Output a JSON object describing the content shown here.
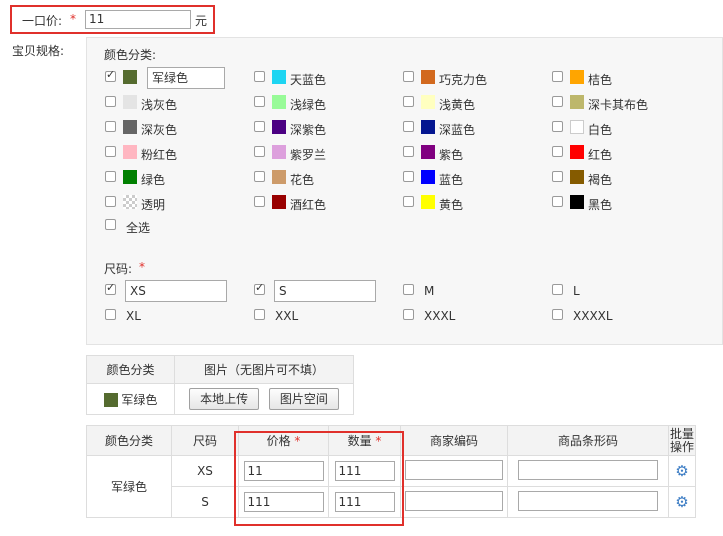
{
  "price": {
    "label": "一口价:",
    "required_mark": "*",
    "value": "11",
    "unit": "元"
  },
  "spec_label": "宝贝规格:",
  "colors": {
    "heading": "颜色分类:",
    "items": [
      {
        "label": "军绿色",
        "color": "#556b2f",
        "checked": true
      },
      {
        "label": "天蓝色",
        "color": "#1ed5f2",
        "checked": false
      },
      {
        "label": "巧克力色",
        "color": "#d2691e",
        "checked": false
      },
      {
        "label": "桔色",
        "color": "#ffa500",
        "checked": false
      },
      {
        "label": "浅灰色",
        "color": "#e4e4e4",
        "checked": false
      },
      {
        "label": "浅绿色",
        "color": "#98fb98",
        "checked": false
      },
      {
        "label": "浅黄色",
        "color": "#ffffc0",
        "checked": false
      },
      {
        "label": "深卡其布色",
        "color": "#bdb76b",
        "checked": false
      },
      {
        "label": "深灰色",
        "color": "#666666",
        "checked": false
      },
      {
        "label": "深紫色",
        "color": "#4b0082",
        "checked": false
      },
      {
        "label": "深蓝色",
        "color": "#041690",
        "checked": false
      },
      {
        "label": "白色",
        "color": "#ffffff",
        "checked": false
      },
      {
        "label": "粉红色",
        "color": "#ffb6c1",
        "checked": false
      },
      {
        "label": "紫罗兰",
        "color": "#dda0dd",
        "checked": false
      },
      {
        "label": "紫色",
        "color": "#800080",
        "checked": false
      },
      {
        "label": "红色",
        "color": "#ff0000",
        "checked": false
      },
      {
        "label": "绿色",
        "color": "#008000",
        "checked": false
      },
      {
        "label": "花色",
        "color": "#cd9b6a",
        "checked": false
      },
      {
        "label": "蓝色",
        "color": "#0000ff",
        "checked": false
      },
      {
        "label": "褐色",
        "color": "#855b00",
        "checked": false
      },
      {
        "label": "透明",
        "color": "transparent",
        "checked": false
      },
      {
        "label": "酒红色",
        "color": "#990000",
        "checked": false
      },
      {
        "label": "黄色",
        "color": "#ffff00",
        "checked": false
      },
      {
        "label": "黑色",
        "color": "#000000",
        "checked": false
      }
    ],
    "select_all": "全选"
  },
  "sizes": {
    "heading": "尺码:",
    "required_mark": "*",
    "items": [
      {
        "label": "XS",
        "checked": true
      },
      {
        "label": "S",
        "checked": true
      },
      {
        "label": "M",
        "checked": false
      },
      {
        "label": "L",
        "checked": false
      },
      {
        "label": "XL",
        "checked": false
      },
      {
        "label": "XXL",
        "checked": false
      },
      {
        "label": "XXXL",
        "checked": false
      },
      {
        "label": "XXXXL",
        "checked": false
      }
    ]
  },
  "image_table": {
    "col_color": "颜色分类",
    "col_image": "图片（无图片可不填）",
    "row": {
      "color_label": "军绿色",
      "color": "#556b2f",
      "upload_button": "本地上传",
      "space_button": "图片空间"
    }
  },
  "sku_table": {
    "headers": {
      "color": "颜色分类",
      "size": "尺码",
      "price": "价格",
      "qty": "数量",
      "merchant_code": "商家编码",
      "barcode": "商品条形码",
      "batch_line1": "批量",
      "batch_line2": "操作"
    },
    "required_mark": "*",
    "color_cell": "军绿色",
    "rows": [
      {
        "size": "XS",
        "price": "11",
        "qty": "111",
        "merchant_code": "",
        "barcode": ""
      },
      {
        "size": "S",
        "price": "111",
        "qty": "111",
        "merchant_code": "",
        "barcode": ""
      }
    ]
  }
}
